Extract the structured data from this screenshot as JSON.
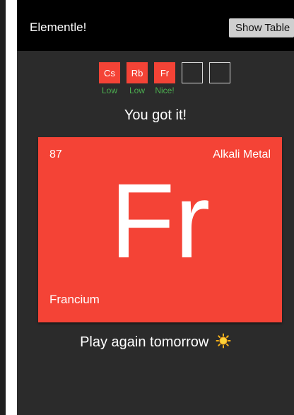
{
  "header": {
    "title": "Elementle!",
    "show_table_label": "Show Table"
  },
  "guesses": [
    {
      "symbol": "Cs",
      "hint": "Low"
    },
    {
      "symbol": "Rb",
      "hint": "Low"
    },
    {
      "symbol": "Fr",
      "hint": "Nice!"
    },
    {
      "symbol": "",
      "hint": ""
    },
    {
      "symbol": "",
      "hint": ""
    }
  ],
  "result_message": "You got it!",
  "element": {
    "atomic_number": "87",
    "category": "Alkali Metal",
    "symbol": "Fr",
    "name": "Francium"
  },
  "footer": {
    "message": "Play again tomorrow",
    "icon": "sun-icon"
  },
  "colors": {
    "accent": "#f44336",
    "hint_green": "#4caf50",
    "background": "#2b2b2b",
    "topbar": "#000000"
  }
}
